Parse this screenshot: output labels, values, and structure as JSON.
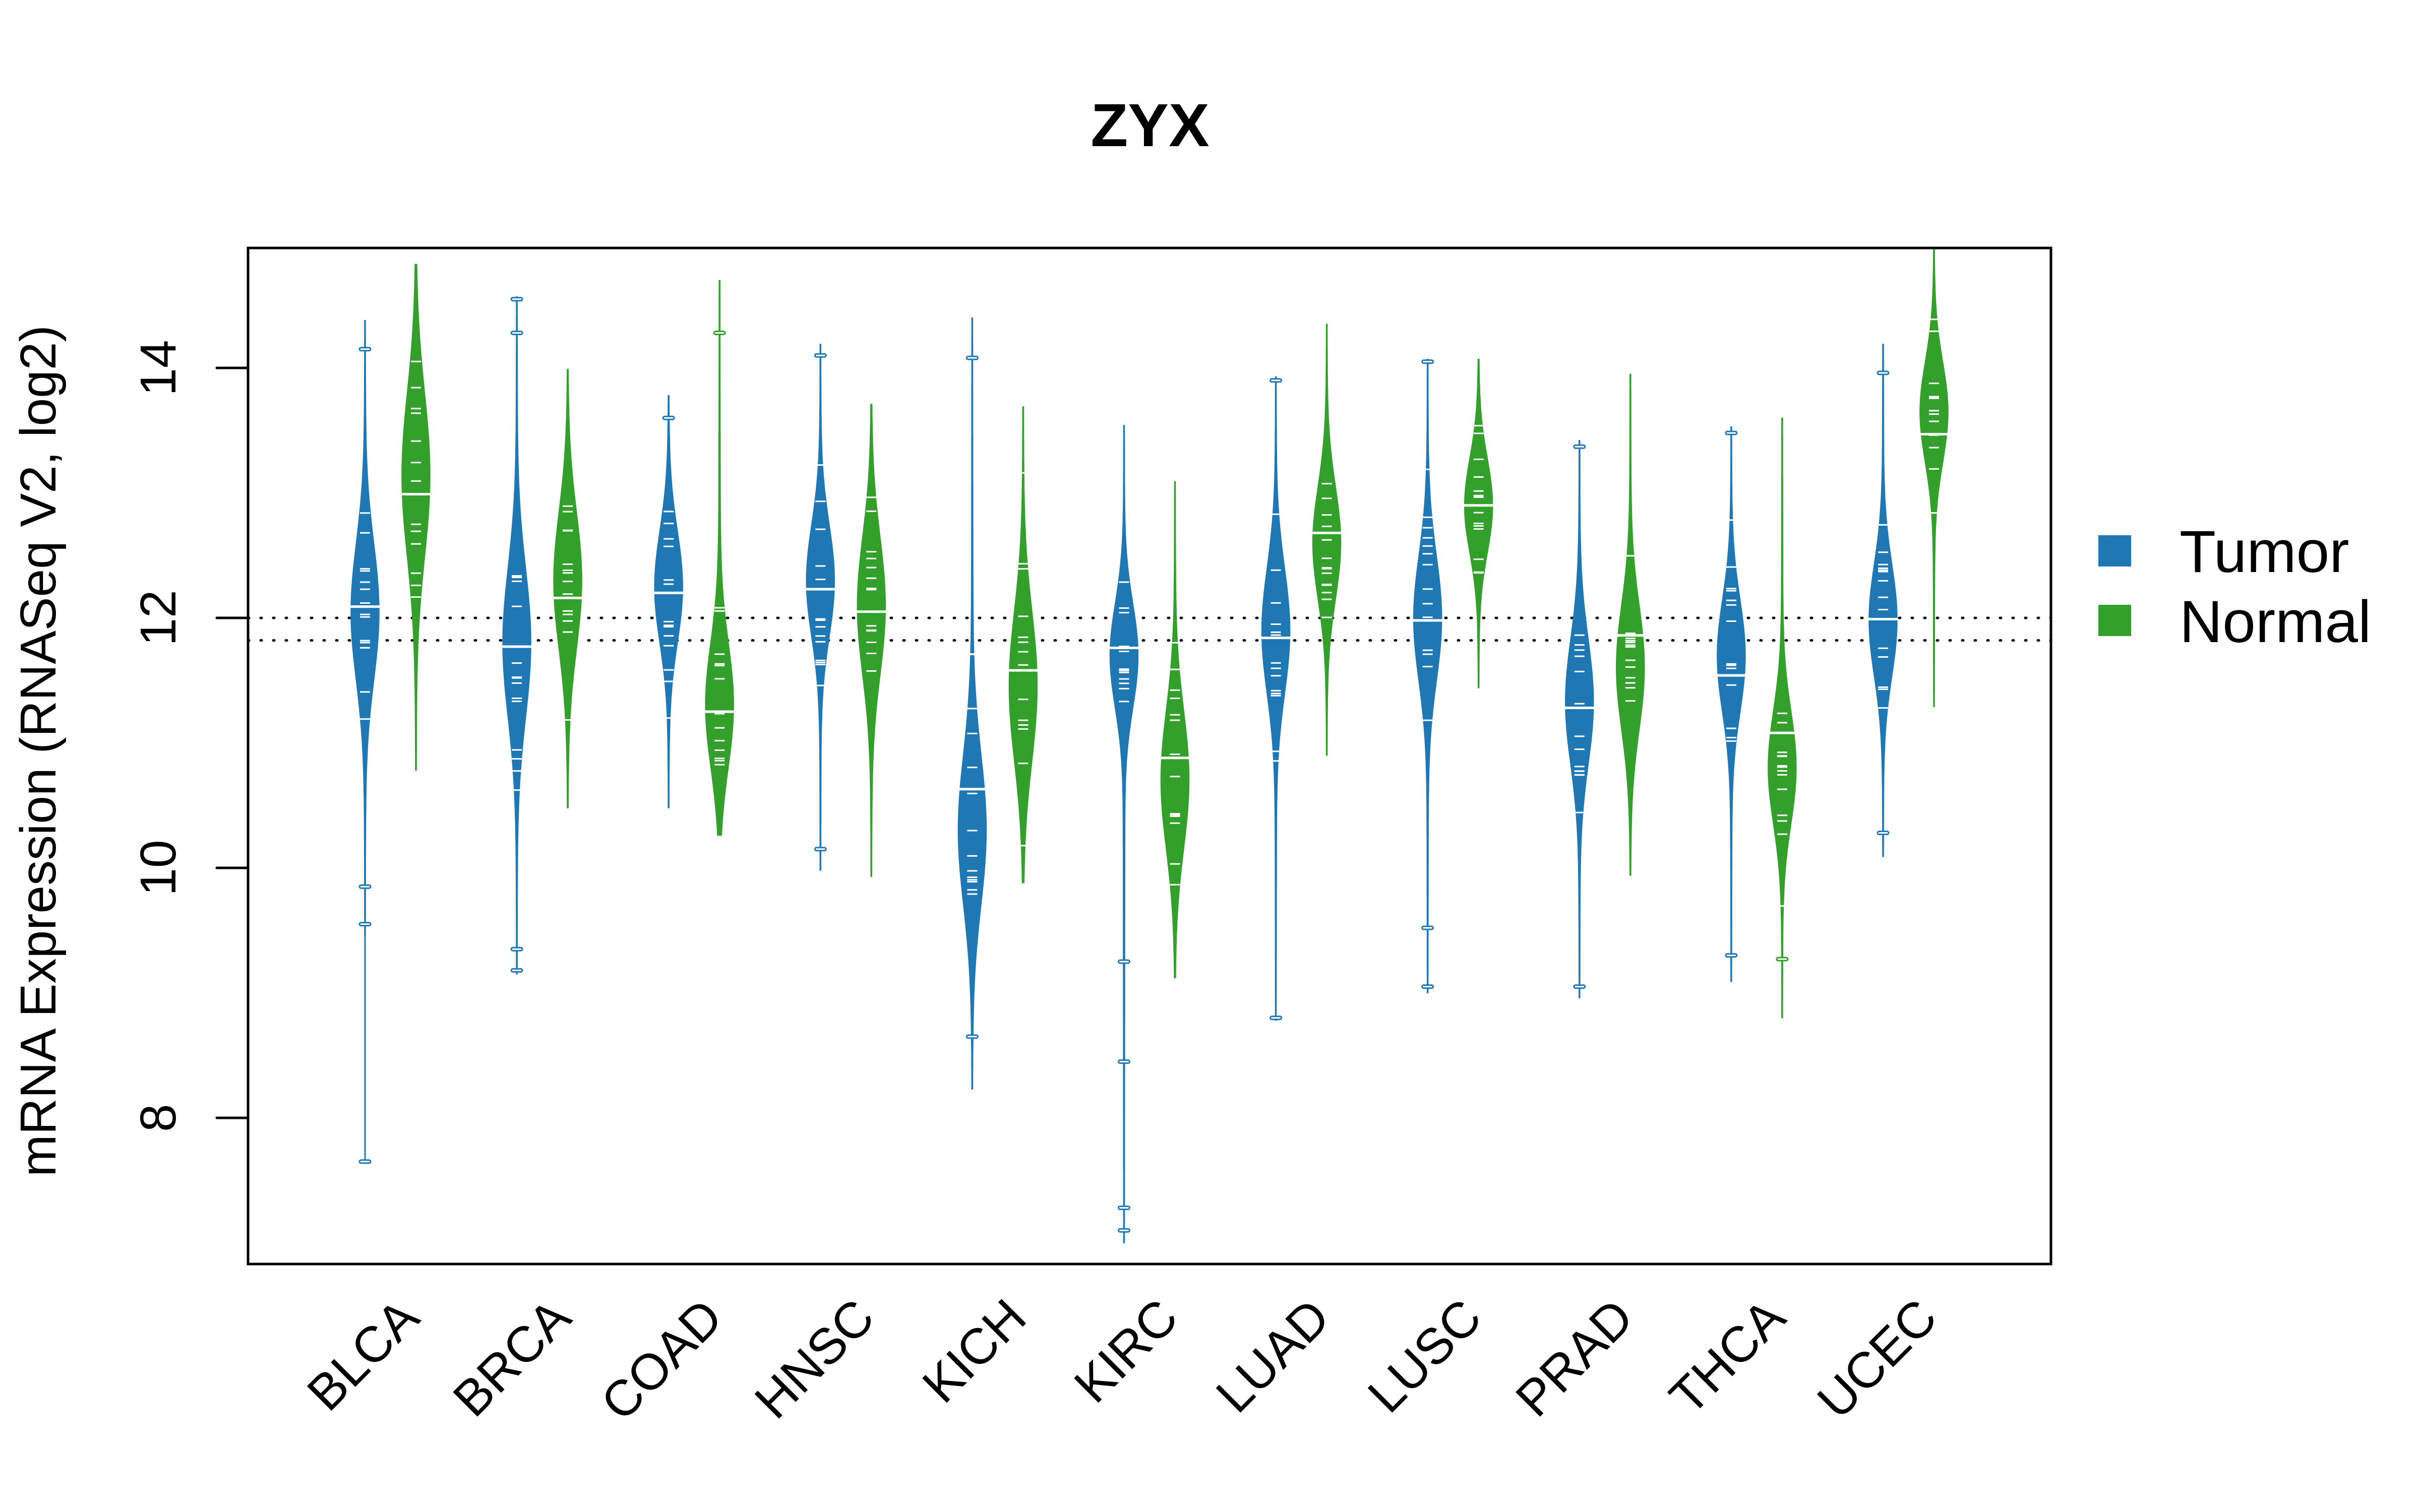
{
  "chart_data": {
    "type": "violin",
    "title": "ZYX",
    "xlabel": "",
    "ylabel": "mRNA Expression (RNASeq V2, log2)",
    "ylim": [
      6.83,
      14.96
    ],
    "yticks": [
      8,
      10,
      12,
      14
    ],
    "ytick_labels": [
      "8",
      "10",
      "12",
      "14"
    ],
    "grid": false,
    "reference_lines": [
      12.0,
      11.82
    ],
    "reference_line_style": "dotted",
    "legend": {
      "position": "right",
      "entries": [
        {
          "label": "Tumor",
          "color": "#1F78B4"
        },
        {
          "label": "Normal",
          "color": "#33A02C"
        }
      ]
    },
    "categories": [
      "BLCA",
      "BRCA",
      "COAD",
      "HNSC",
      "KICH",
      "KIRC",
      "LUAD",
      "LUSC",
      "PRAD",
      "THCA",
      "UCEC"
    ],
    "series": [
      {
        "name": "Tumor",
        "color": "#1F78B4",
        "values": [
          {
            "min": 9.45,
            "max": 14.38,
            "median": 12.09,
            "mode": 12.05,
            "sd": 0.55,
            "outliers": [
              7.65,
              9.55,
              9.85,
              14.15
            ]
          },
          {
            "min": 9.15,
            "max": 14.57,
            "median": 11.77,
            "mode": 11.8,
            "sd": 0.6,
            "outliers": [
              9.18,
              9.35,
              14.28,
              14.55
            ]
          },
          {
            "min": 10.48,
            "max": 13.78,
            "median": 12.2,
            "mode": 12.25,
            "sd": 0.45,
            "outliers": [
              13.6
            ]
          },
          {
            "min": 9.98,
            "max": 14.19,
            "median": 12.23,
            "mode": 12.3,
            "sd": 0.45,
            "outliers": [
              10.15,
              14.1
            ]
          },
          {
            "min": 8.23,
            "max": 14.4,
            "median": 10.63,
            "mode": 10.3,
            "sd": 0.6,
            "outliers": [
              8.65,
              14.08
            ]
          },
          {
            "min": 7.0,
            "max": 13.54,
            "median": 11.76,
            "mode": 11.7,
            "sd": 0.42,
            "outliers": [
              7.1,
              7.28,
              8.45,
              9.25
            ]
          },
          {
            "min": 8.78,
            "max": 13.93,
            "median": 11.84,
            "mode": 11.9,
            "sd": 0.5,
            "outliers": [
              8.8,
              13.9
            ]
          },
          {
            "min": 9.0,
            "max": 14.07,
            "median": 11.98,
            "mode": 12.0,
            "sd": 0.5,
            "outliers": [
              9.05,
              9.52,
              14.05
            ]
          },
          {
            "min": 8.96,
            "max": 13.42,
            "median": 11.28,
            "mode": 11.33,
            "sd": 0.5,
            "outliers": [
              9.05,
              13.37
            ]
          },
          {
            "min": 9.09,
            "max": 13.53,
            "median": 11.54,
            "mode": 11.7,
            "sd": 0.45,
            "outliers": [
              9.3,
              13.48
            ]
          },
          {
            "min": 10.09,
            "max": 14.19,
            "median": 11.99,
            "mode": 11.98,
            "sd": 0.45,
            "outliers": [
              10.28,
              13.96
            ]
          }
        ]
      },
      {
        "name": "Normal",
        "color": "#33A02C",
        "values": [
          {
            "min": 10.78,
            "max": 14.83,
            "median": 12.99,
            "mode": 13.15,
            "sd": 0.65,
            "outliers": []
          },
          {
            "min": 10.48,
            "max": 13.99,
            "median": 12.16,
            "mode": 12.3,
            "sd": 0.55,
            "outliers": []
          },
          {
            "min": 10.26,
            "max": 14.7,
            "median": 11.25,
            "mode": 11.3,
            "sd": 0.5,
            "outliers": [
              14.28
            ]
          },
          {
            "min": 9.93,
            "max": 13.71,
            "median": 12.05,
            "mode": 12.1,
            "sd": 0.55,
            "outliers": []
          },
          {
            "min": 9.88,
            "max": 13.69,
            "median": 11.58,
            "mode": 11.45,
            "sd": 0.6,
            "outliers": []
          },
          {
            "min": 9.12,
            "max": 13.09,
            "median": 10.88,
            "mode": 10.7,
            "sd": 0.55,
            "outliers": []
          },
          {
            "min": 10.9,
            "max": 14.35,
            "median": 12.68,
            "mode": 12.6,
            "sd": 0.45,
            "outliers": []
          },
          {
            "min": 11.44,
            "max": 14.07,
            "median": 12.9,
            "mode": 12.9,
            "sd": 0.38,
            "outliers": []
          },
          {
            "min": 9.94,
            "max": 13.95,
            "median": 11.86,
            "mode": 11.6,
            "sd": 0.5,
            "outliers": []
          },
          {
            "min": 8.8,
            "max": 13.6,
            "median": 11.08,
            "mode": 10.8,
            "sd": 0.45,
            "outliers": [
              9.27
            ]
          },
          {
            "min": 11.29,
            "max": 14.95,
            "median": 13.47,
            "mode": 13.65,
            "sd": 0.4,
            "outliers": []
          }
        ]
      }
    ]
  }
}
